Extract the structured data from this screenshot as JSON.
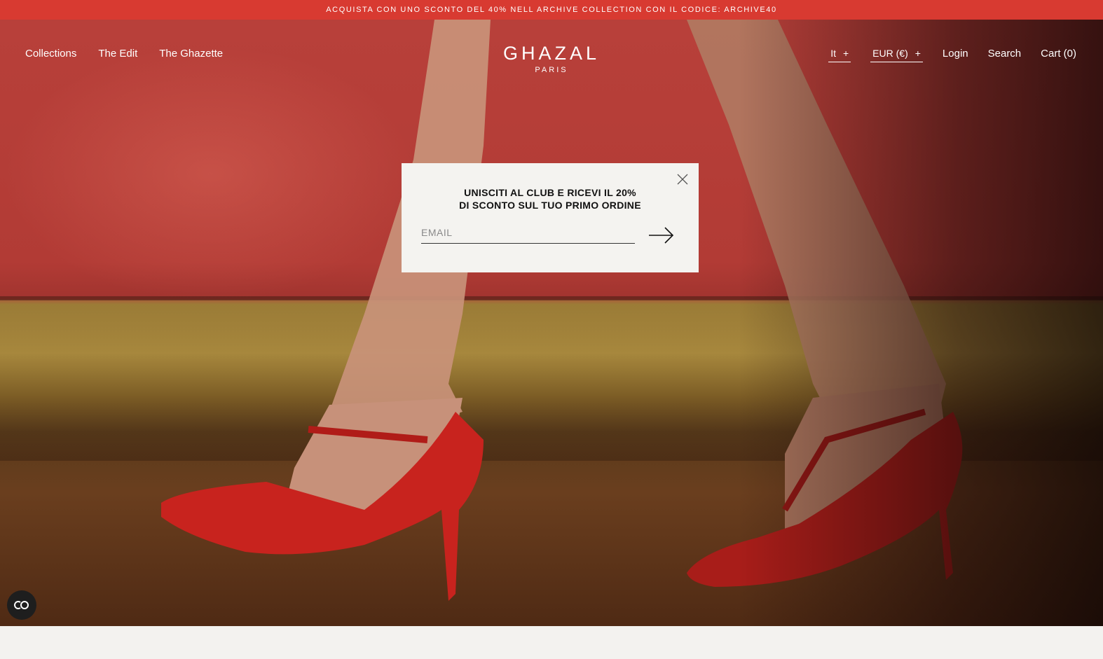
{
  "promo": {
    "text": "ACQUISTA CON UNO SCONTO DEL 40% NELL ARCHIVE COLLECTION CON IL CODICE: ARCHIVE40"
  },
  "nav": {
    "left": [
      {
        "label": "Collections"
      },
      {
        "label": "The Edit"
      },
      {
        "label": "The Ghazette"
      }
    ],
    "language": {
      "label": "It",
      "toggle": "+"
    },
    "currency": {
      "label": "EUR (€)",
      "toggle": "+"
    },
    "login": "Login",
    "search": "Search",
    "cart": "Cart (0)"
  },
  "logo": {
    "name": "GHAZAL",
    "sub": "PARIS"
  },
  "modal": {
    "headline_line1": "UNISCITI AL CLUB E RICEVI IL 20%",
    "headline_line2": "DI SCONTO SUL TUO PRIMO ORDINE",
    "email_placeholder": "EMAIL",
    "close_icon": "close-icon",
    "submit_icon": "arrow-right-icon"
  },
  "accessibility": {
    "icon": "accessibility-icon"
  },
  "colors": {
    "promo_bg": "#d83a31",
    "modal_bg": "#f4f3f0",
    "shoe_red": "#c8231e"
  }
}
